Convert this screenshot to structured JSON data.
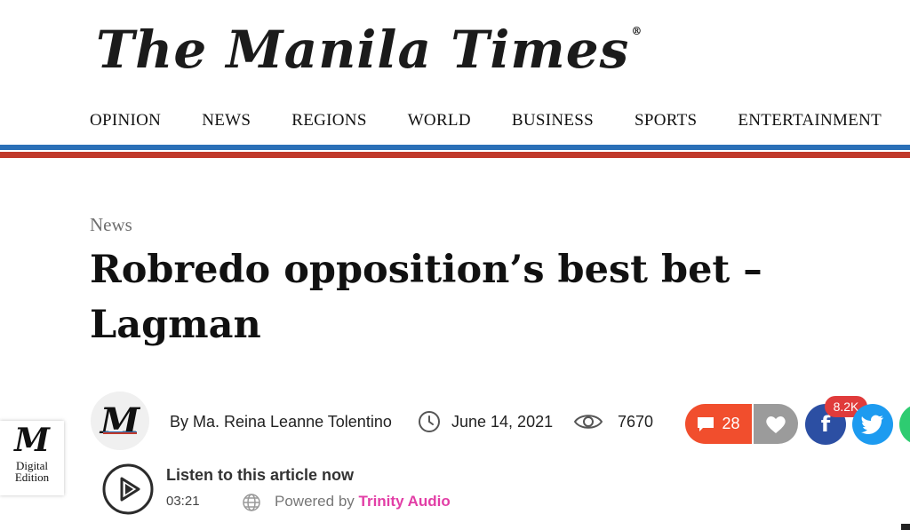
{
  "site": {
    "logo_text": "The Manila Times",
    "reg_mark": "®"
  },
  "nav": {
    "items": [
      "OPINION",
      "NEWS",
      "REGIONS",
      "WORLD",
      "BUSINESS",
      "SPORTS",
      "ENTERTAINMENT"
    ]
  },
  "article": {
    "category": "News",
    "headline": "Robredo opposition’s best bet – Lagman",
    "byline": "By Ma. Reina Leanne Tolentino",
    "date": "June 14, 2021",
    "views": "7670",
    "author_avatar_letter": "M"
  },
  "social": {
    "comments_count": "28",
    "share_count": "8.2K",
    "facebook_glyph": "f"
  },
  "digital_edition": {
    "letter": "M",
    "line1": "Digital",
    "line2": "Edition"
  },
  "audio": {
    "title": "Listen to this article now",
    "duration": "03:21",
    "powered_label": "Powered by",
    "powered_brand": "Trinity Audio"
  },
  "colors": {
    "nav_blue": "#2a6fb7",
    "nav_red": "#c0392b",
    "comment": "#f14e2d",
    "facebook": "#2c4fa3",
    "twitter": "#1d9bf0",
    "trinity": "#e23ea6"
  },
  "icons": [
    "clock-icon",
    "eye-icon",
    "comment-icon",
    "heart-icon",
    "facebook-icon",
    "twitter-icon",
    "whatsapp-icon",
    "play-icon",
    "globe-icon"
  ]
}
